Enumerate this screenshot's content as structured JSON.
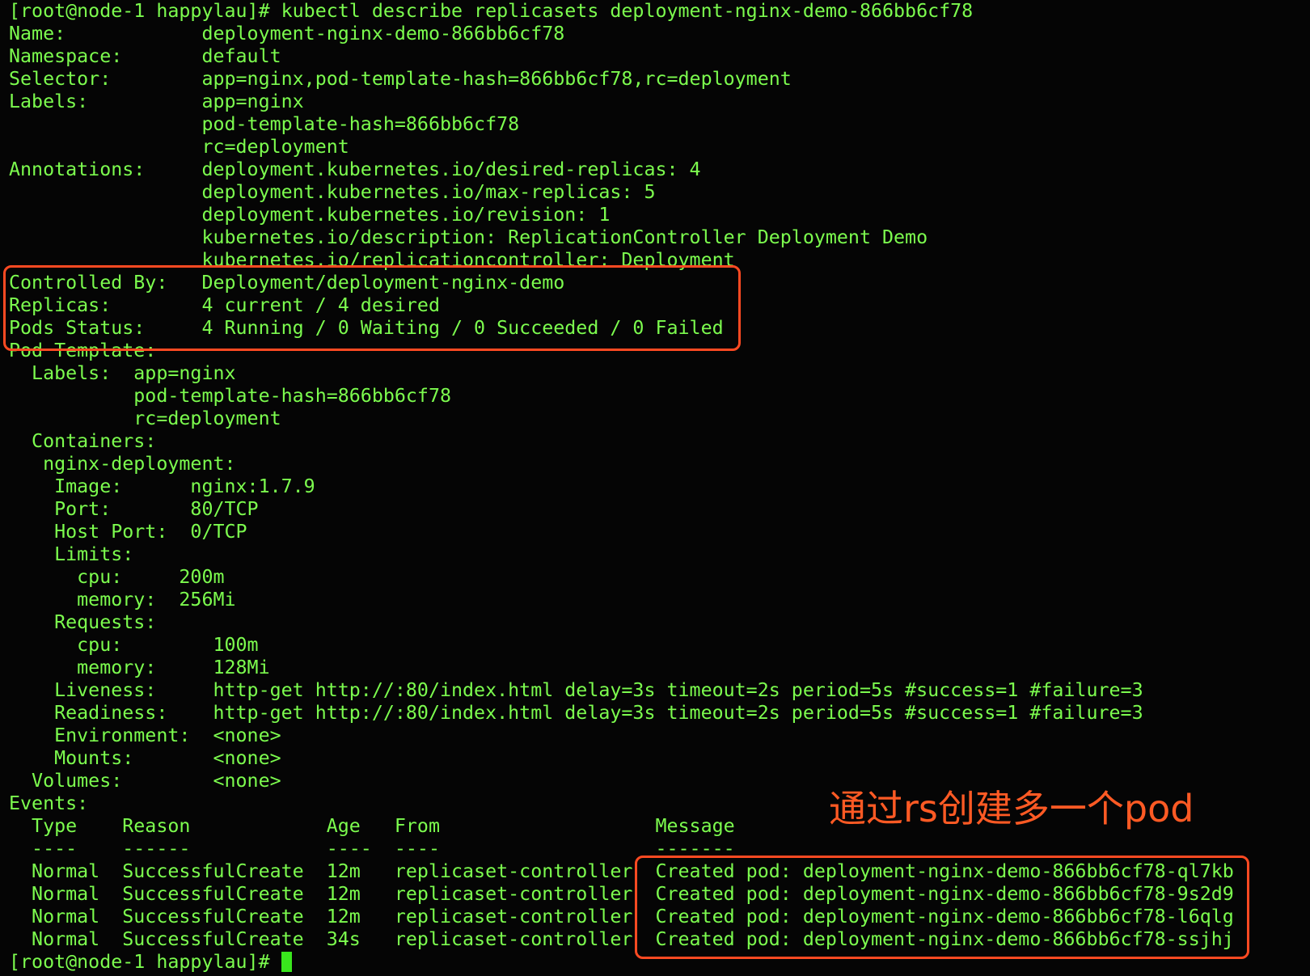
{
  "terminal": {
    "lines": [
      "[root@node-1 happylau]# kubectl describe replicasets deployment-nginx-demo-866bb6cf78",
      "Name:            deployment-nginx-demo-866bb6cf78",
      "Namespace:       default",
      "Selector:        app=nginx,pod-template-hash=866bb6cf78,rc=deployment",
      "Labels:          app=nginx",
      "                 pod-template-hash=866bb6cf78",
      "                 rc=deployment",
      "Annotations:     deployment.kubernetes.io/desired-replicas: 4",
      "                 deployment.kubernetes.io/max-replicas: 5",
      "                 deployment.kubernetes.io/revision: 1",
      "                 kubernetes.io/description: ReplicationController Deployment Demo",
      "                 kubernetes.io/replicationcontroller: Deployment",
      "Controlled By:   Deployment/deployment-nginx-demo",
      "Replicas:        4 current / 4 desired",
      "Pods Status:     4 Running / 0 Waiting / 0 Succeeded / 0 Failed",
      "Pod Template:",
      "  Labels:  app=nginx",
      "           pod-template-hash=866bb6cf78",
      "           rc=deployment",
      "  Containers:",
      "   nginx-deployment:",
      "    Image:      nginx:1.7.9",
      "    Port:       80/TCP",
      "    Host Port:  0/TCP",
      "    Limits:",
      "      cpu:     200m",
      "      memory:  256Mi",
      "    Requests:",
      "      cpu:        100m",
      "      memory:     128Mi",
      "    Liveness:     http-get http://:80/index.html delay=3s timeout=2s period=5s #success=1 #failure=3",
      "    Readiness:    http-get http://:80/index.html delay=3s timeout=2s period=5s #success=1 #failure=3",
      "    Environment:  <none>",
      "    Mounts:       <none>",
      "  Volumes:        <none>",
      "Events:",
      "  Type    Reason            Age   From                   Message",
      "  ----    ------            ----  ----                   -------",
      "  Normal  SuccessfulCreate  12m   replicaset-controller  Created pod: deployment-nginx-demo-866bb6cf78-ql7kb",
      "  Normal  SuccessfulCreate  12m   replicaset-controller  Created pod: deployment-nginx-demo-866bb6cf78-9s2d9",
      "  Normal  SuccessfulCreate  12m   replicaset-controller  Created pod: deployment-nginx-demo-866bb6cf78-l6qlg",
      "  Normal  SuccessfulCreate  34s   replicaset-controller  Created pod: deployment-nginx-demo-866bb6cf78-ssjhj"
    ],
    "prompt": "[root@node-1 happylau]# "
  },
  "annotation": {
    "note": "通过rs创建多一个pod"
  },
  "colors": {
    "text": "#7CFC4E",
    "background": "#050505",
    "highlight": "#ff4a22"
  }
}
